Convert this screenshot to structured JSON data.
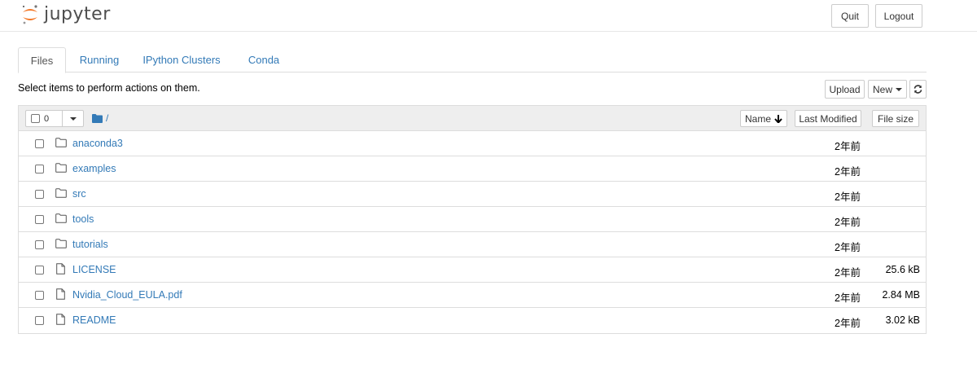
{
  "header": {
    "logo_text": "jupyter",
    "quit_label": "Quit",
    "logout_label": "Logout"
  },
  "tabs": [
    {
      "label": "Files",
      "active": true
    },
    {
      "label": "Running",
      "active": false
    },
    {
      "label": "IPython Clusters",
      "active": false
    },
    {
      "label": "Conda",
      "active": false
    }
  ],
  "toolbar": {
    "select_text": "Select items to perform actions on them.",
    "upload_label": "Upload",
    "new_label": "New",
    "refresh_icon": "refresh-icon"
  },
  "list_header": {
    "selected_count": "0",
    "breadcrumb": "/",
    "sort_name_label": "Name",
    "sort_modified_label": "Last Modified",
    "sort_size_label": "File size"
  },
  "items": [
    {
      "type": "folder",
      "name": "anaconda3",
      "modified": "2年前",
      "size": ""
    },
    {
      "type": "folder",
      "name": "examples",
      "modified": "2年前",
      "size": ""
    },
    {
      "type": "folder",
      "name": "src",
      "modified": "2年前",
      "size": ""
    },
    {
      "type": "folder",
      "name": "tools",
      "modified": "2年前",
      "size": ""
    },
    {
      "type": "folder",
      "name": "tutorials",
      "modified": "2年前",
      "size": ""
    },
    {
      "type": "file",
      "name": "LICENSE",
      "modified": "2年前",
      "size": "25.6 kB"
    },
    {
      "type": "file",
      "name": "Nvidia_Cloud_EULA.pdf",
      "modified": "2年前",
      "size": "2.84 MB"
    },
    {
      "type": "file",
      "name": "README",
      "modified": "2年前",
      "size": "3.02 kB"
    }
  ],
  "colors": {
    "link": "#337ab7",
    "logo_orange": "#f37726",
    "header_bg": "#eeeeee"
  }
}
